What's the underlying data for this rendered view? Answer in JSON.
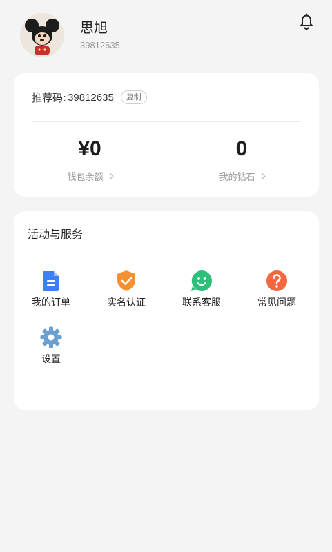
{
  "profile": {
    "name": "思旭",
    "id": "39812635"
  },
  "account": {
    "referral_label": "推荐码:",
    "referral_code": "39812635",
    "copy_label": "复制",
    "wallet_value": "¥0",
    "wallet_label": "钱包余额",
    "diamond_value": "0",
    "diamond_label": "我的钻石"
  },
  "services": {
    "title": "活动与服务",
    "items": [
      {
        "label": "我的订单",
        "icon": "document-icon",
        "color": "#3d7ff5"
      },
      {
        "label": "实名认证",
        "icon": "shield-check-icon",
        "color": "#f5912f"
      },
      {
        "label": "联系客服",
        "icon": "smiley-icon",
        "color": "#2ec07a"
      },
      {
        "label": "常见问题",
        "icon": "question-icon",
        "color": "#f4683f"
      },
      {
        "label": "设置",
        "icon": "gear-icon",
        "color": "#6a9fd0"
      }
    ]
  }
}
